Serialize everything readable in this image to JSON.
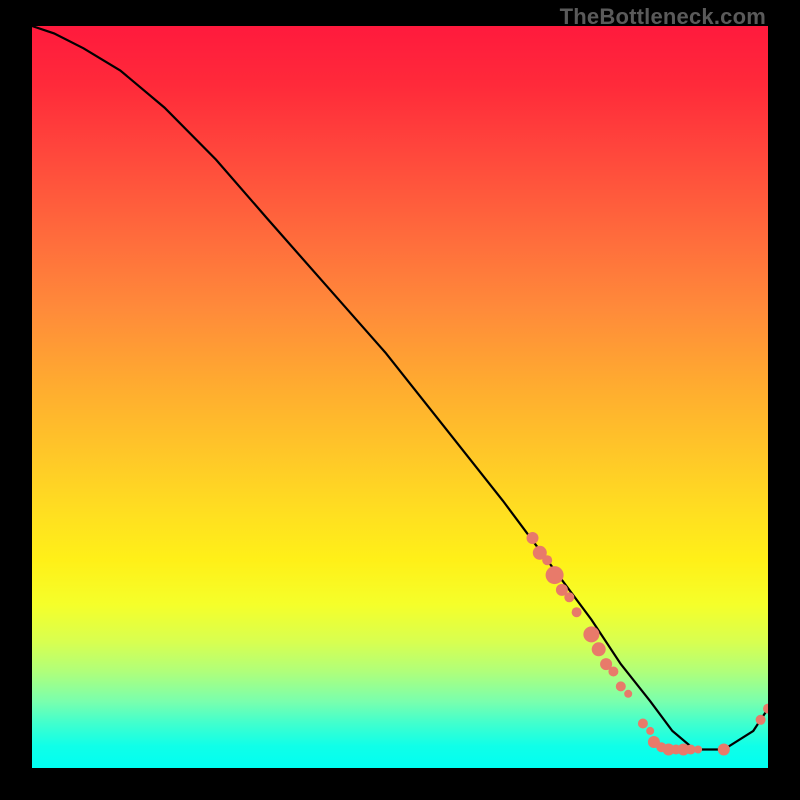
{
  "watermark": "TheBottleneck.com",
  "chart_data": {
    "type": "line",
    "title": "",
    "xlabel": "",
    "ylabel": "",
    "xlim": [
      0,
      100
    ],
    "ylim": [
      0,
      100
    ],
    "grid": false,
    "legend": false,
    "series": [
      {
        "name": "curve",
        "kind": "line",
        "x": [
          0,
          3,
          7,
          12,
          18,
          25,
          32,
          40,
          48,
          56,
          64,
          70,
          76,
          80,
          84,
          87,
          90,
          94,
          98,
          100
        ],
        "y": [
          100,
          99,
          97,
          94,
          89,
          82,
          74,
          65,
          56,
          46,
          36,
          28,
          20,
          14,
          9,
          5,
          2.5,
          2.5,
          5,
          8
        ]
      },
      {
        "name": "markers",
        "kind": "scatter",
        "points": [
          {
            "x": 68,
            "y": 31,
            "r": 6
          },
          {
            "x": 69,
            "y": 29,
            "r": 7
          },
          {
            "x": 70,
            "y": 28,
            "r": 5
          },
          {
            "x": 71,
            "y": 26,
            "r": 9
          },
          {
            "x": 72,
            "y": 24,
            "r": 6
          },
          {
            "x": 73,
            "y": 23,
            "r": 5
          },
          {
            "x": 74,
            "y": 21,
            "r": 5
          },
          {
            "x": 76,
            "y": 18,
            "r": 8
          },
          {
            "x": 77,
            "y": 16,
            "r": 7
          },
          {
            "x": 78,
            "y": 14,
            "r": 6
          },
          {
            "x": 79,
            "y": 13,
            "r": 5
          },
          {
            "x": 80,
            "y": 11,
            "r": 5
          },
          {
            "x": 81,
            "y": 10,
            "r": 4
          },
          {
            "x": 83,
            "y": 6,
            "r": 5
          },
          {
            "x": 84,
            "y": 5,
            "r": 4
          },
          {
            "x": 84.5,
            "y": 3.5,
            "r": 6
          },
          {
            "x": 85.5,
            "y": 2.8,
            "r": 5
          },
          {
            "x": 86.5,
            "y": 2.5,
            "r": 6
          },
          {
            "x": 87.5,
            "y": 2.5,
            "r": 5
          },
          {
            "x": 88.5,
            "y": 2.5,
            "r": 6
          },
          {
            "x": 89.5,
            "y": 2.5,
            "r": 5
          },
          {
            "x": 90.5,
            "y": 2.5,
            "r": 4
          },
          {
            "x": 94,
            "y": 2.5,
            "r": 6
          },
          {
            "x": 99,
            "y": 6.5,
            "r": 5
          },
          {
            "x": 100,
            "y": 8,
            "r": 5
          }
        ]
      }
    ]
  }
}
